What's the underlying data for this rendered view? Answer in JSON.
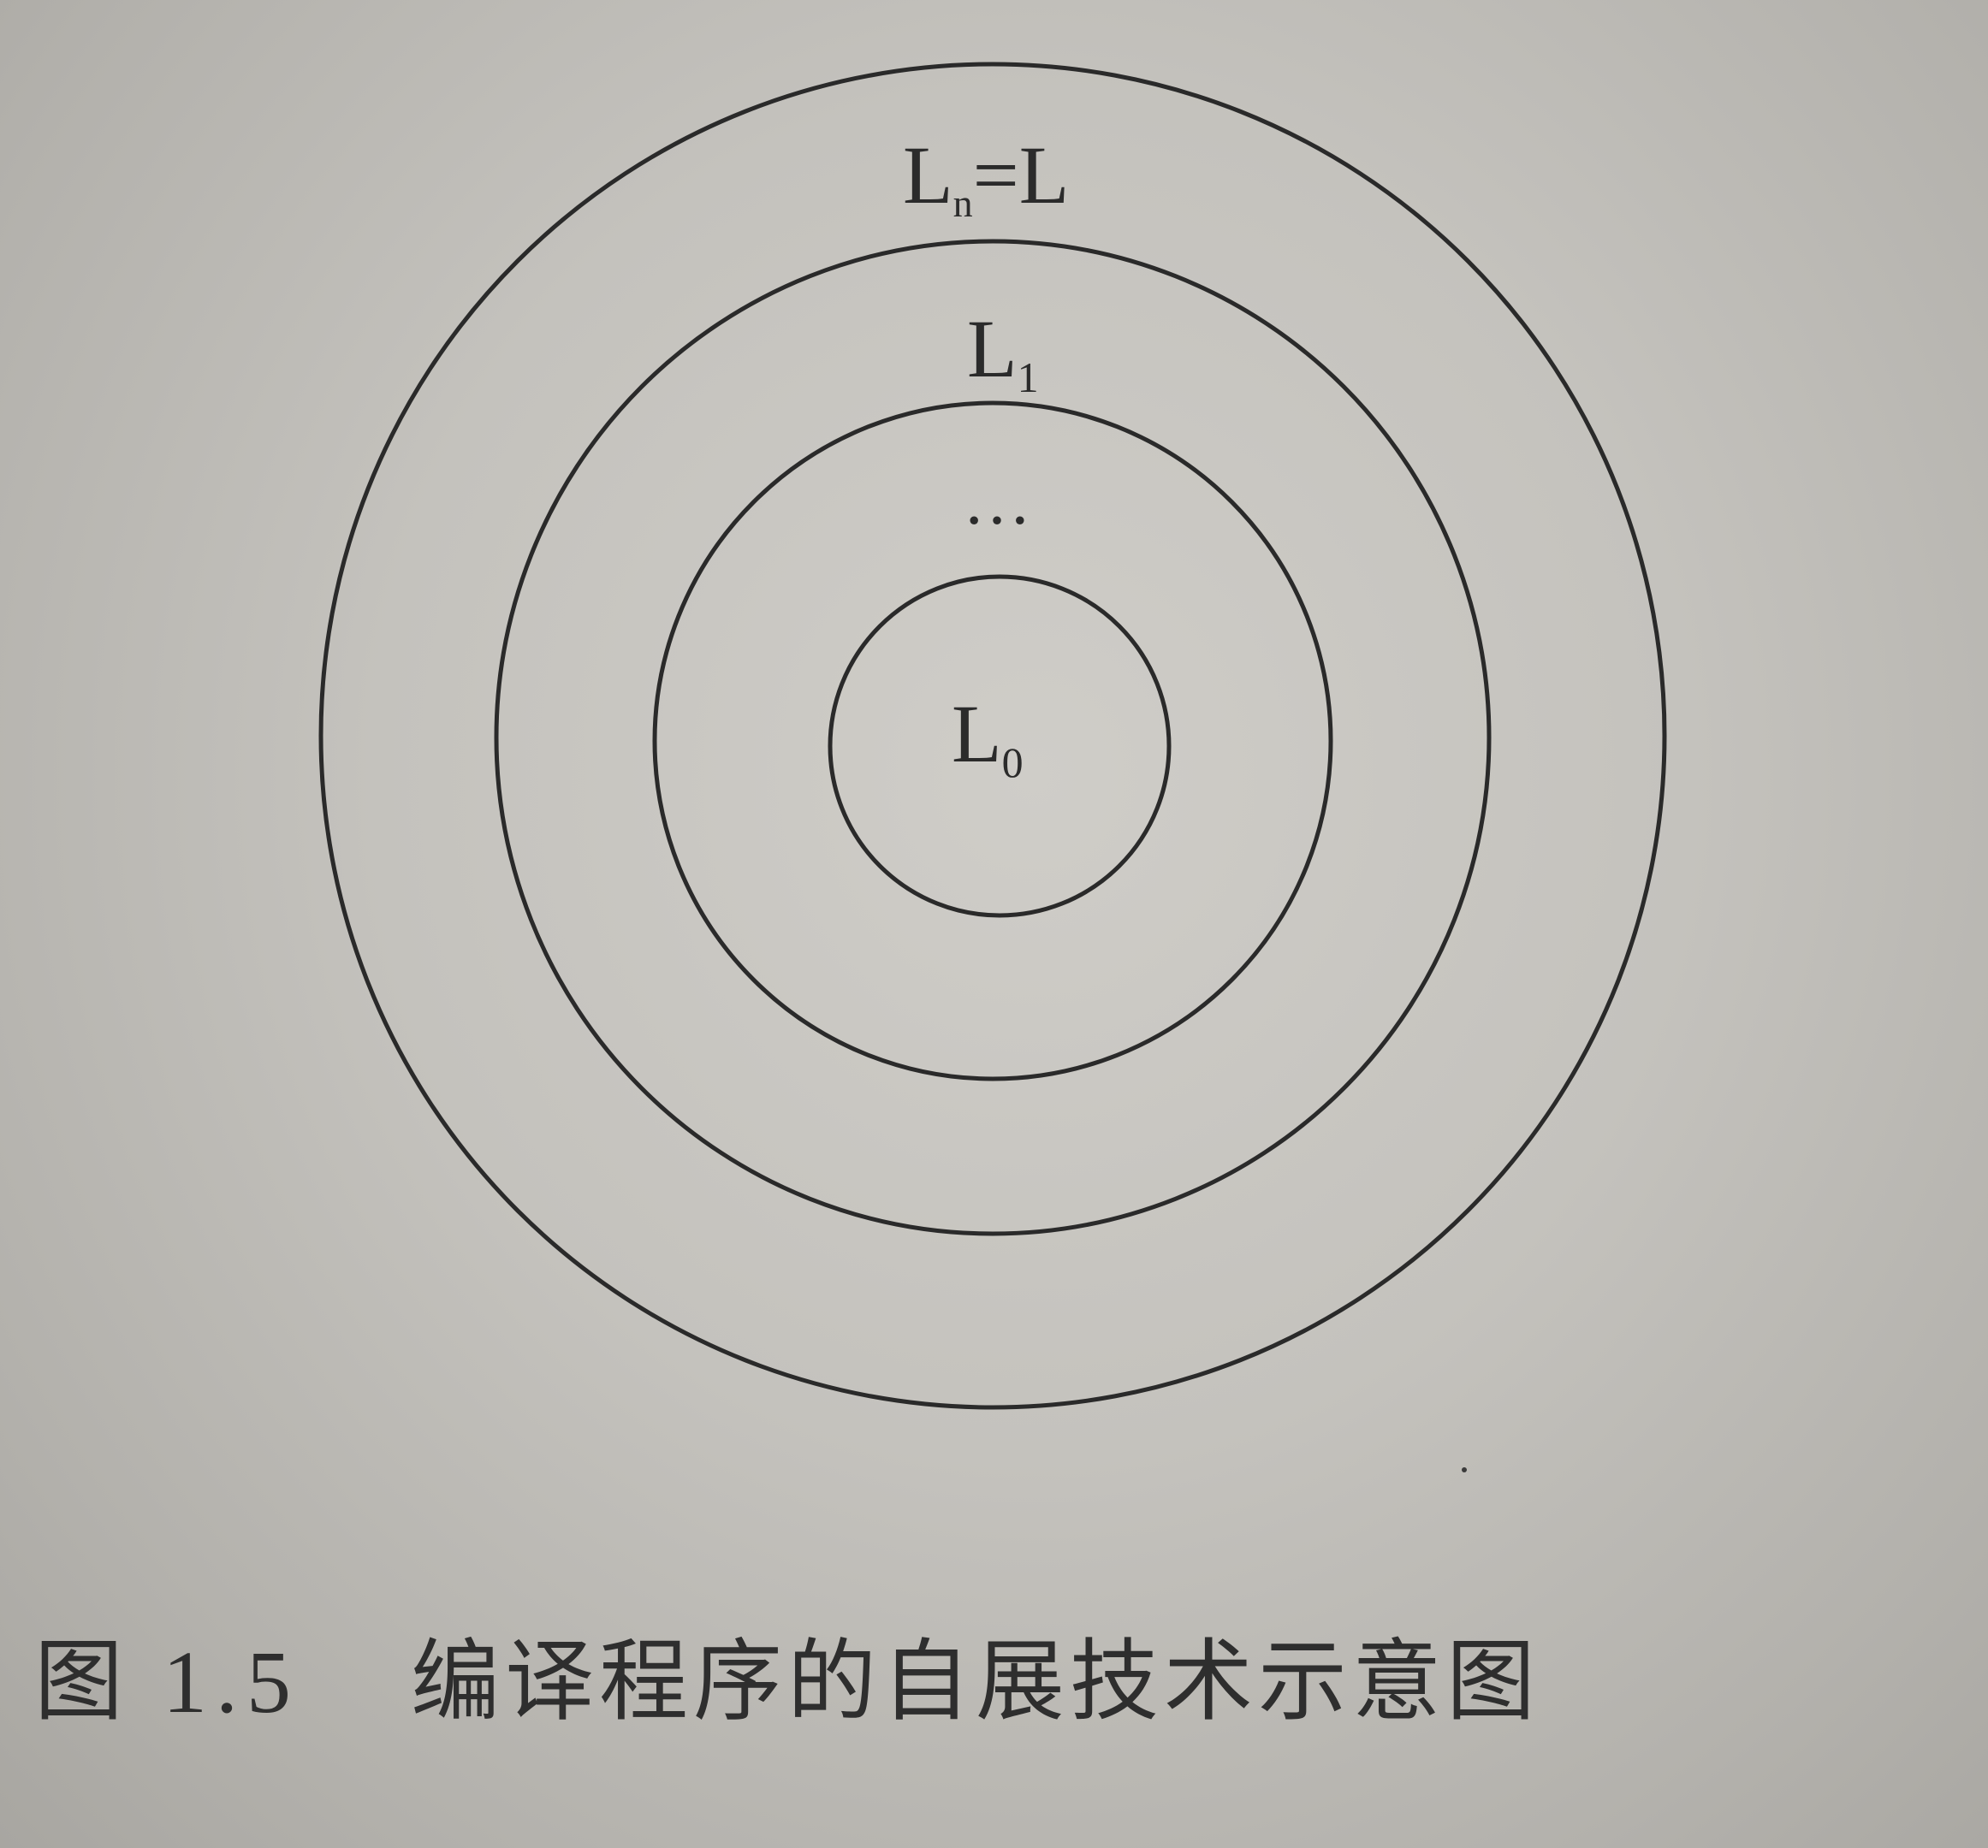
{
  "diagram": {
    "rings": [
      {
        "name": "ring-outer"
      },
      {
        "name": "ring-second"
      },
      {
        "name": "ring-third"
      },
      {
        "name": "ring-inner"
      }
    ],
    "labels": {
      "outer": {
        "base": "L",
        "sub": "n",
        "suffix": "=L"
      },
      "second": {
        "base": "L",
        "sub": "1"
      },
      "ellipsis": "…",
      "inner": {
        "base": "L",
        "sub": "0"
      }
    }
  },
  "caption": {
    "figure_number": "图 1.5",
    "title": "编译程序的自展技术示意图"
  }
}
